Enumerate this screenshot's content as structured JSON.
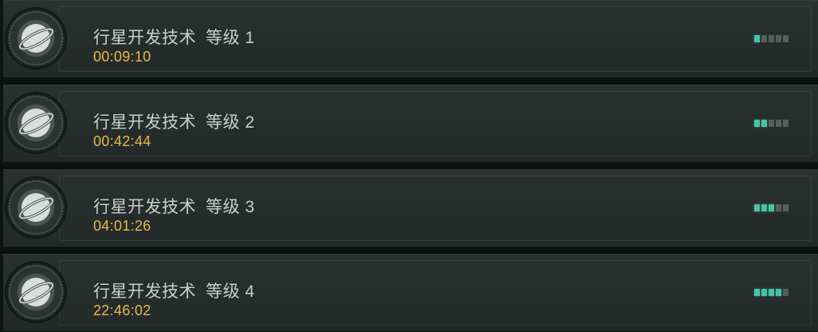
{
  "colors": {
    "accent": "#49c2a7",
    "timer": "#e8b84a",
    "title": "#c8cfcc",
    "pip_off": "#575f5d"
  },
  "research_queue": [
    {
      "name": "行星开发技术",
      "level_label": "等级 1",
      "timer": "00:09:10",
      "level": 1,
      "max_level": 5,
      "icon": "planet-icon"
    },
    {
      "name": "行星开发技术",
      "level_label": "等级 2",
      "timer": "00:42:44",
      "level": 2,
      "max_level": 5,
      "icon": "planet-icon"
    },
    {
      "name": "行星开发技术",
      "level_label": "等级 3",
      "timer": "04:01:26",
      "level": 3,
      "max_level": 5,
      "icon": "planet-icon"
    },
    {
      "name": "行星开发技术",
      "level_label": "等级 4",
      "timer": "22:46:02",
      "level": 4,
      "max_level": 5,
      "icon": "planet-icon"
    }
  ]
}
